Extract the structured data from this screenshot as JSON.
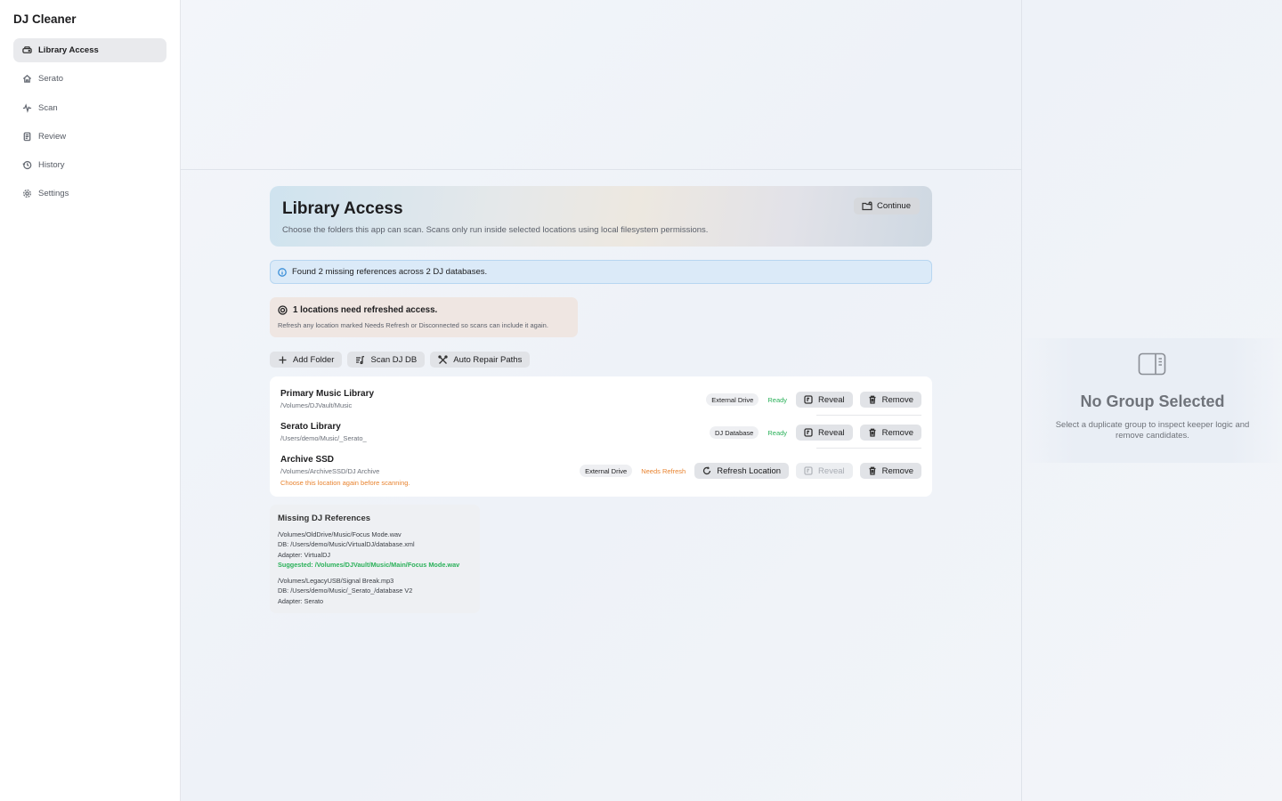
{
  "app": {
    "title": "DJ Cleaner"
  },
  "sidebar": {
    "items": [
      {
        "label": "Library Access",
        "icon": "drive-icon",
        "active": true
      },
      {
        "label": "Serato",
        "icon": "house-icon"
      },
      {
        "label": "Scan",
        "icon": "waveform-icon"
      },
      {
        "label": "Review",
        "icon": "document-icon"
      },
      {
        "label": "History",
        "icon": "clock-icon"
      },
      {
        "label": "Settings",
        "icon": "gear-icon"
      }
    ]
  },
  "hero": {
    "title": "Library Access",
    "subtitle": "Choose the folders this app can scan. Scans only run inside selected locations using local filesystem permissions.",
    "continue_label": "Continue"
  },
  "info_banner": {
    "text": "Found 2 missing references across 2 DJ databases."
  },
  "warning": {
    "title": "1 locations need refreshed access.",
    "subtitle": "Refresh any location marked Needs Refresh or Disconnected so scans can include it again."
  },
  "actions": {
    "add_folder": "Add Folder",
    "scan_db": "Scan DJ DB",
    "auto_repair": "Auto Repair Paths"
  },
  "locations": [
    {
      "name": "Primary Music Library",
      "path": "/Volumes/DJVault/Music",
      "tag": "External Drive",
      "status": "Ready",
      "reveal": "Reveal",
      "remove": "Remove"
    },
    {
      "name": "Serato Library",
      "path": "/Users/demo/Music/_Serato_",
      "tag": "DJ Database",
      "status": "Ready",
      "reveal": "Reveal",
      "remove": "Remove"
    },
    {
      "name": "Archive SSD",
      "path": "/Volumes/ArchiveSSD/DJ Archive",
      "warning": "Choose this location again before scanning.",
      "tag": "External Drive",
      "status": "Needs Refresh",
      "refresh": "Refresh Location",
      "reveal": "Reveal",
      "remove": "Remove"
    }
  ],
  "missing": {
    "title": "Missing DJ References",
    "refs": [
      {
        "file": "/Volumes/OldDrive/Music/Focus Mode.wav",
        "db": "DB: /Users/demo/Music/VirtualDJ/database.xml",
        "adapter": "Adapter: VirtualDJ",
        "suggested": "Suggested: /Volumes/DJVault/Music/Main/Focus Mode.wav"
      },
      {
        "file": "/Volumes/LegacyUSB/Signal Break.mp3",
        "db": "DB: /Users/demo/Music/_Serato_/database V2",
        "adapter": "Adapter: Serato"
      }
    ]
  },
  "inspector": {
    "empty_title": "No Group Selected",
    "empty_subtitle": "Select a duplicate group to inspect keeper logic and remove candidates."
  },
  "colors": {
    "ready": "#2bb15a",
    "needs_refresh": "#e8832f",
    "info": "#3b8fd8"
  }
}
